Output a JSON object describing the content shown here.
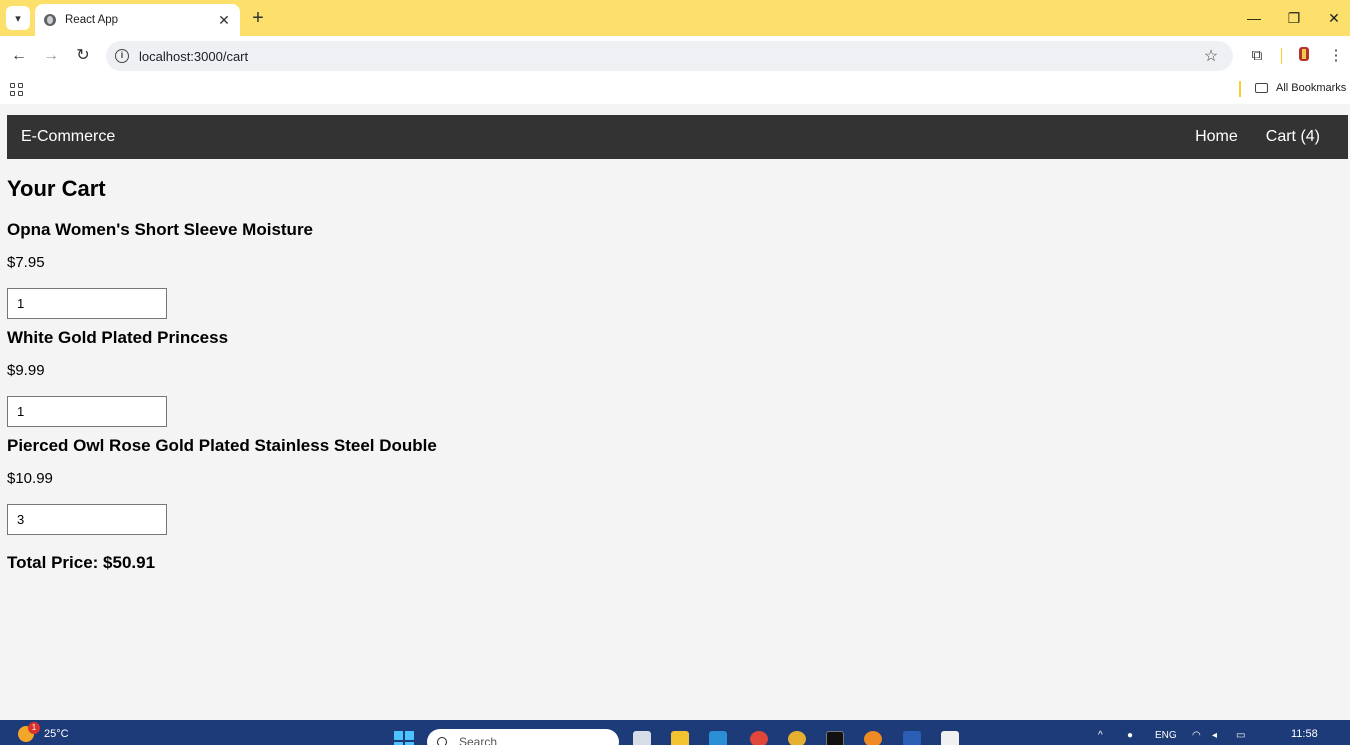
{
  "browser": {
    "tab_title": "React App",
    "url": "localhost:3000/cart",
    "bookmarks_label": "All Bookmarks"
  },
  "navbar": {
    "brand": "E-Commerce",
    "home": "Home",
    "cart": "Cart (4)"
  },
  "cart": {
    "title": "Your Cart",
    "items": [
      {
        "name": "Opna Women's Short Sleeve Moisture",
        "price": "$7.95",
        "quantity": "1"
      },
      {
        "name": "White Gold Plated Princess",
        "price": "$9.99",
        "quantity": "1"
      },
      {
        "name": "Pierced Owl Rose Gold Plated Stainless Steel Double",
        "price": "$10.99",
        "quantity": "3"
      }
    ],
    "total": "Total Price: $50.91"
  },
  "taskbar": {
    "temperature": "25°C",
    "weather_badge": "1",
    "search_placeholder": "Search",
    "language": "ENG",
    "time": "11:58"
  },
  "colors": {
    "tabbar": "#fde06b",
    "navbar": "#333333",
    "taskbar": "#1d3b78"
  }
}
